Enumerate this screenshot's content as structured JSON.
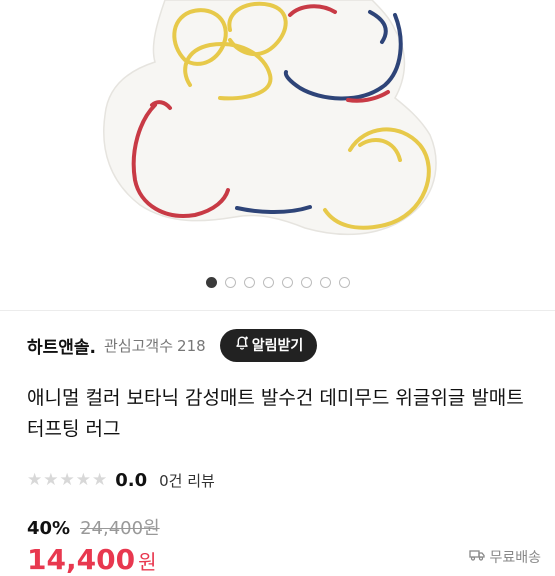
{
  "gallery": {
    "slide_count": 8,
    "active_index": 0,
    "image_icon": "cloud-rug-product-photo"
  },
  "seller": {
    "name": "하트앤솔.",
    "followers_label": "관심고객수",
    "followers_count": "218",
    "follow_button_label": "알림받기",
    "follow_icon": "bell-plus-icon"
  },
  "product": {
    "title": "애니멀 컬러 보타닉 감성매트 발수건 데미무드 위글위글 발매트 터프팅 러그"
  },
  "rating": {
    "score": "0.0",
    "stars_filled": 0,
    "stars_total": 5,
    "review_count_label": "0건 리뷰"
  },
  "price": {
    "discount": "40%",
    "original": "24,400원",
    "sale_amount": "14,400",
    "sale_unit": "원"
  },
  "shipping": {
    "label": "무료배송"
  },
  "colors": {
    "sale_red": "#e8384f",
    "follow_button_bg": "#222222",
    "active_dot": "#3a3a3a"
  }
}
